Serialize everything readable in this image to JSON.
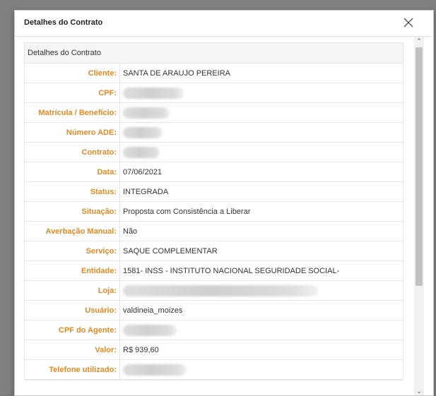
{
  "modal": {
    "title": "Detalhes do Contrato",
    "close_icon": "close-icon",
    "panel_heading": "Detalhes do Contrato"
  },
  "rows": [
    {
      "label": "Cliente:",
      "value": "SANTA DE ARAUJO PEREIRA"
    },
    {
      "label": "CPF:",
      "value": ""
    },
    {
      "label": "Matrícula / Benefício:",
      "value": ""
    },
    {
      "label": "Número ADE:",
      "value": ""
    },
    {
      "label": "Contrato:",
      "value": ""
    },
    {
      "label": "Data:",
      "value": "07/06/2021"
    },
    {
      "label": "Status:",
      "value": "INTEGRADA"
    },
    {
      "label": "Situação:",
      "value": "Proposta com Consistência a Liberar"
    },
    {
      "label": "Averbação Manual:",
      "value": "Não"
    },
    {
      "label": "Serviço:",
      "value": "SAQUE COMPLEMENTAR"
    },
    {
      "label": "Entidade:",
      "value": "1581- INSS - INSTITUTO NACIONAL SEGURIDADE SOCIAL-"
    },
    {
      "label": "Loja:",
      "value": ""
    },
    {
      "label": "Usuário:",
      "value": "valdineia_moizes"
    },
    {
      "label": "CPF do Agente:",
      "value": ""
    },
    {
      "label": "Valor:",
      "value": "R$ 939,60"
    },
    {
      "label": "Telefone utilizado:",
      "value": ""
    }
  ],
  "colors": {
    "label": "#e8871e",
    "text": "#333333"
  }
}
